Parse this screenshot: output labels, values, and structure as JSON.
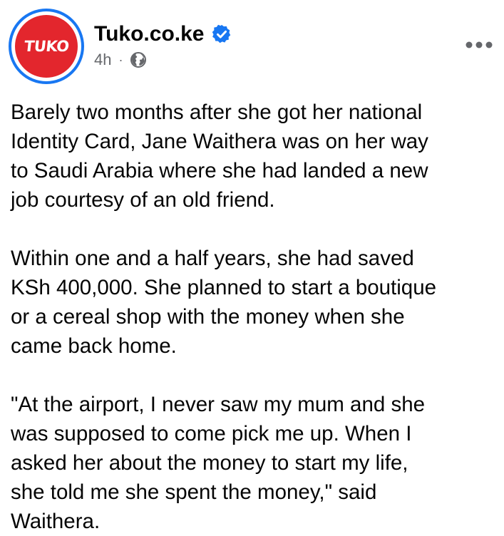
{
  "post": {
    "author": {
      "name": "Tuko.co.ke",
      "avatar_text": "TUKO",
      "verified": true,
      "time": "4h",
      "separator": "·",
      "privacy_icon": "globe-icon"
    },
    "more_icon": "more-horizontal-icon",
    "paragraphs": [
      "Barely two months after she got her national\nIdentity Card, Jane Waithera was on her way\nto Saudi Arabia where she had landed a new\njob courtesy of an old friend.",
      "Within one and a half years, she had saved\nKSh 400,000. She planned to start a boutique\nor a cereal shop with the money when she\ncame back home.",
      "\"At the airport, I never saw my mum and she\nwas supposed to come pick me up. When I\nasked her about the money to start my life,\nshe told me she spent the money,\" said\nWaithera."
    ]
  },
  "colors": {
    "brand_red": "#e3262d",
    "ring_blue": "#1877f2",
    "verified_blue": "#1877f2",
    "text_primary": "#050505",
    "text_secondary": "#65676b"
  }
}
